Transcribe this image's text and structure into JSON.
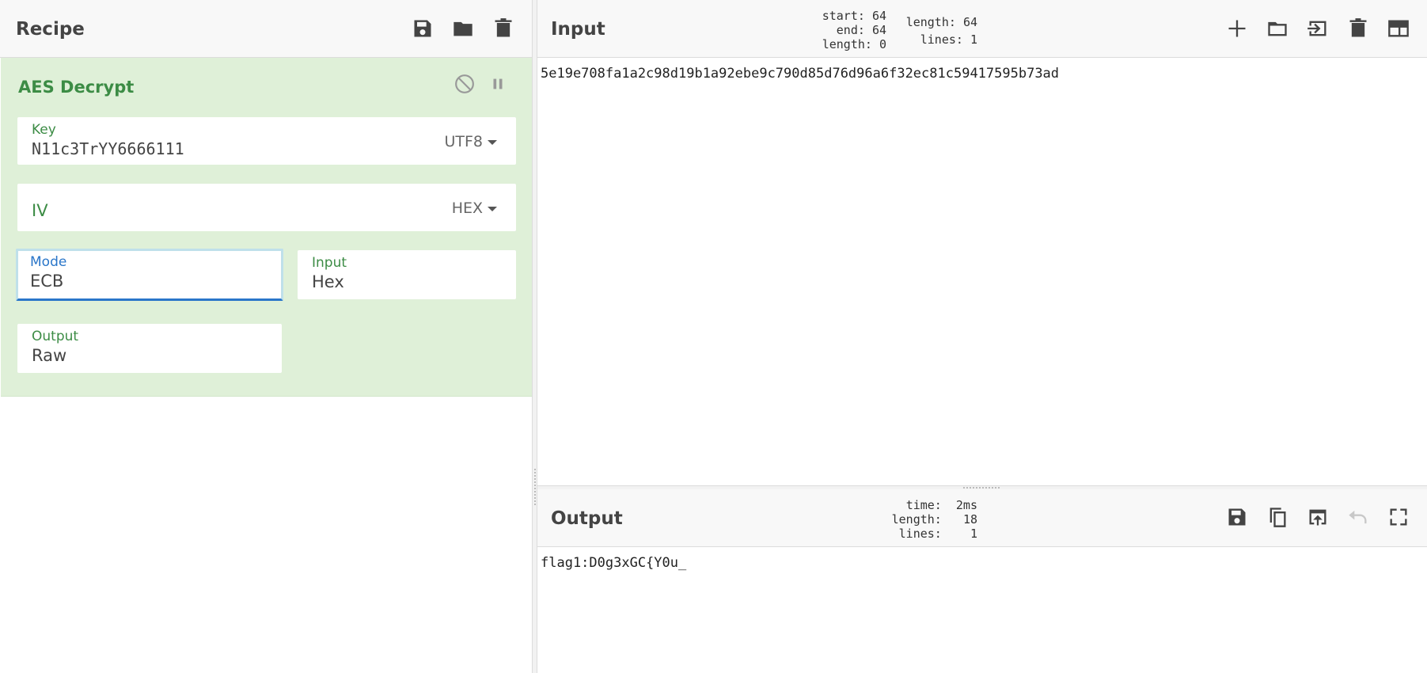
{
  "recipe": {
    "title": "Recipe",
    "operation": {
      "name": "AES Decrypt",
      "key": {
        "label": "Key",
        "value": "N11c3TrYY6666111",
        "encoding": "UTF8"
      },
      "iv": {
        "label": "IV",
        "value": "",
        "encoding": "HEX"
      },
      "mode": {
        "label": "Mode",
        "value": "ECB"
      },
      "input": {
        "label": "Input",
        "value": "Hex"
      },
      "output": {
        "label": "Output",
        "value": "Raw"
      }
    }
  },
  "input": {
    "title": "Input",
    "stats": {
      "start_label": "start:",
      "start": "64",
      "end_label": "end:",
      "end": "64",
      "sel_length_label": "length:",
      "sel_length": "0",
      "length_label": "length:",
      "length": "64",
      "lines_label": "lines:",
      "lines": "1"
    },
    "text": "5e19e708fa1a2c98d19b1a92ebe9c790d85d76d96a6f32ec81c59417595b73ad"
  },
  "output": {
    "title": "Output",
    "stats": {
      "time_label": "time:",
      "time": "2ms",
      "length_label": "length:",
      "length": "18",
      "lines_label": "lines:",
      "lines": "1"
    },
    "text": "flag1:D0g3xGC{Y0u_"
  }
}
